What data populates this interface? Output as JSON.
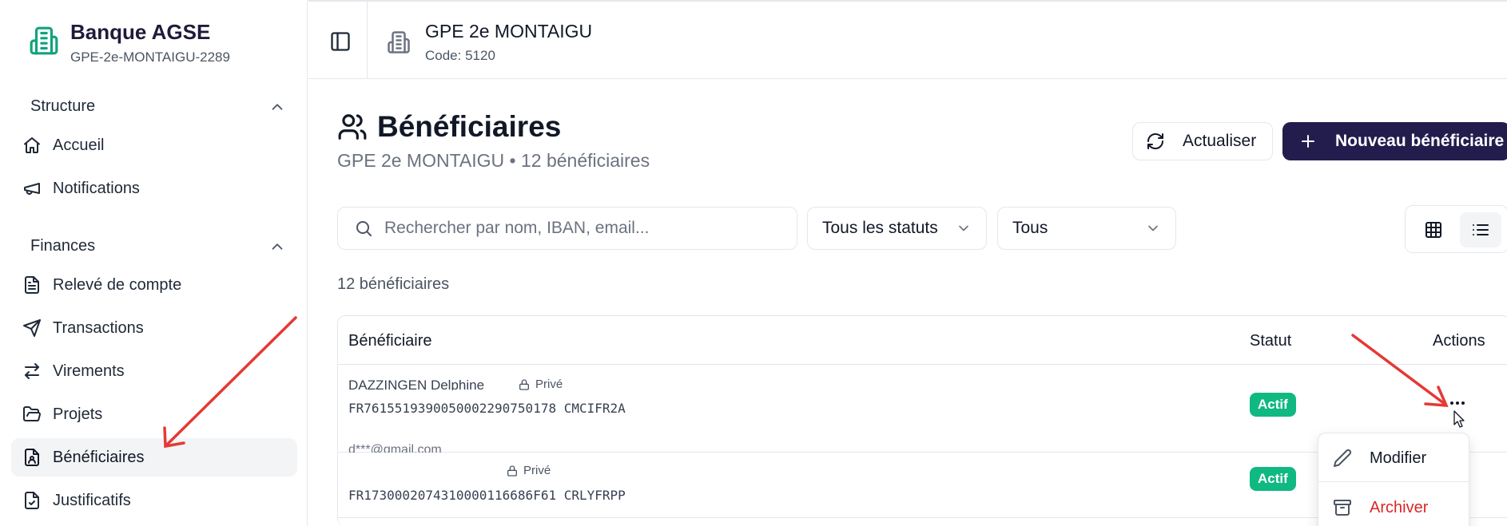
{
  "sidebar": {
    "brand_name": "Banque AGSE",
    "brand_code": "GPE-2e-MONTAIGU-2289",
    "sections": [
      {
        "title": "Structure"
      },
      {
        "title": "Finances"
      }
    ],
    "items": [
      {
        "label": "Accueil",
        "icon": "home-icon"
      },
      {
        "label": "Notifications",
        "icon": "megaphone-icon"
      },
      {
        "label": "Relevé de compte",
        "icon": "document-icon"
      },
      {
        "label": "Transactions",
        "icon": "send-icon"
      },
      {
        "label": "Virements",
        "icon": "arrows-exchange-icon"
      },
      {
        "label": "Projets",
        "icon": "folder-icon"
      },
      {
        "label": "Bénéficiaires",
        "icon": "contact-file-icon",
        "active": true
      },
      {
        "label": "Justificatifs",
        "icon": "receipt-icon"
      }
    ]
  },
  "topbar": {
    "org_name": "GPE 2e MONTAIGU",
    "org_code": "Code: 5120"
  },
  "main": {
    "title": "Bénéficiaires",
    "subtitle": "GPE 2e MONTAIGU • 12 bénéficiaires",
    "refresh_label": "Actualiser",
    "new_label": "Nouveau bénéficiaire",
    "search_placeholder": "Rechercher par nom, IBAN, email...",
    "status_filter": "Tous les statuts",
    "type_filter": "Tous",
    "count_label": "12 bénéficiaires"
  },
  "table": {
    "columns": [
      "Bénéficiaire",
      "Statut",
      "Actions"
    ],
    "rows": [
      {
        "name": "DAZZINGEN Delphine",
        "privacy": "Privé",
        "iban": "FR7615519390050002290750178 CMCIFR2A",
        "email": "d***@gmail.com",
        "status": "Actif"
      },
      {
        "privacy": "Privé",
        "iban": "FR1730002074310000116686F61 CRLYFRPP",
        "status": "Actif"
      }
    ]
  },
  "menu": {
    "items": [
      {
        "label": "Modifier",
        "icon": "pencil-icon"
      },
      {
        "label": "Archiver",
        "icon": "archive-icon"
      }
    ]
  },
  "colors": {
    "brand_green": "#10a37f",
    "primary_dark": "#231d4d",
    "badge_green": "#10b981",
    "danger": "#dc2626",
    "annotation_red": "#e53935"
  }
}
